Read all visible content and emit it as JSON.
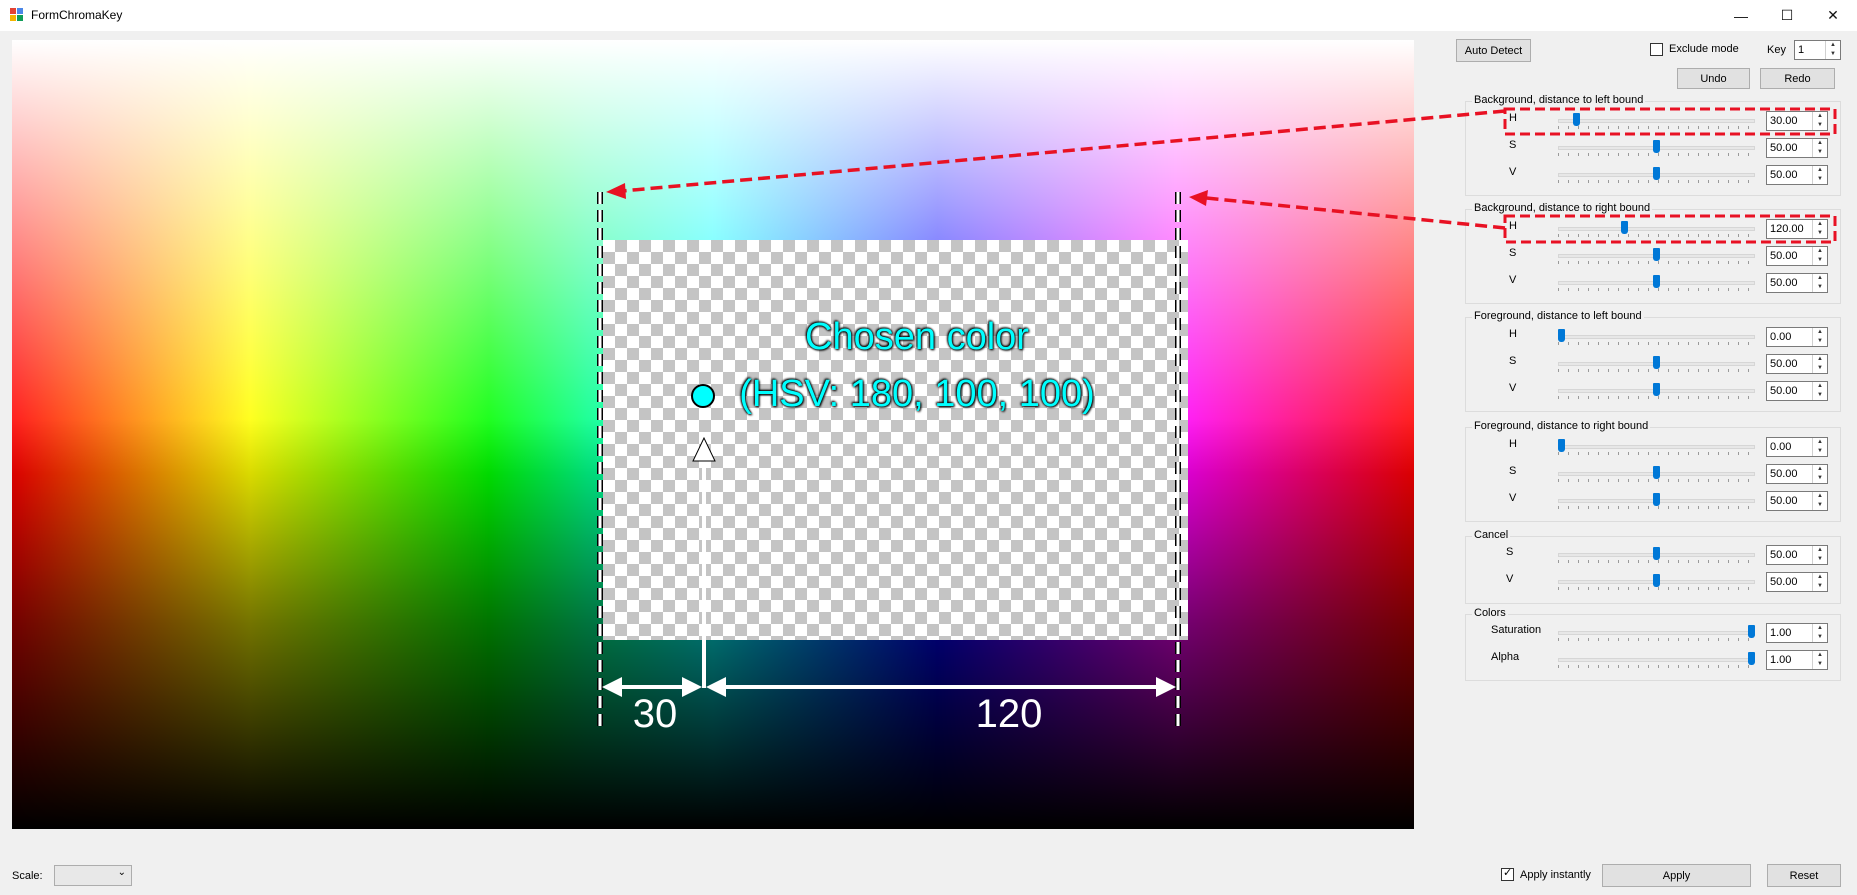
{
  "window": {
    "title": "FormChromaKey",
    "minimize_icon": "—",
    "maximize_icon": "☐",
    "close_icon": "✕"
  },
  "canvas": {
    "chosen_color_line1": "Chosen color",
    "chosen_color_line2": "(HSV: 180, 100, 100)",
    "left_distance": "30",
    "right_distance": "120"
  },
  "toolbar": {
    "auto_detect": "Auto Detect",
    "exclude_mode": "Exclude mode",
    "exclude_checked": false,
    "key_label": "Key",
    "key_value": "1",
    "undo": "Undo",
    "redo": "Redo"
  },
  "groups": {
    "bg_left": {
      "title": "Background, distance to left bound",
      "rows": [
        {
          "label": "H",
          "value": "30.00",
          "fraction": 0.08
        },
        {
          "label": "S",
          "value": "50.00",
          "fraction": 0.5
        },
        {
          "label": "V",
          "value": "50.00",
          "fraction": 0.5
        }
      ]
    },
    "bg_right": {
      "title": "Background, distance to right bound",
      "rows": [
        {
          "label": "H",
          "value": "120.00",
          "fraction": 0.33
        },
        {
          "label": "S",
          "value": "50.00",
          "fraction": 0.5
        },
        {
          "label": "V",
          "value": "50.00",
          "fraction": 0.5
        }
      ]
    },
    "fg_left": {
      "title": "Foreground, distance to left bound",
      "rows": [
        {
          "label": "H",
          "value": "0.00",
          "fraction": 0.0
        },
        {
          "label": "S",
          "value": "50.00",
          "fraction": 0.5
        },
        {
          "label": "V",
          "value": "50.00",
          "fraction": 0.5
        }
      ]
    },
    "fg_right": {
      "title": "Foreground, distance to right bound",
      "rows": [
        {
          "label": "H",
          "value": "0.00",
          "fraction": 0.0
        },
        {
          "label": "S",
          "value": "50.00",
          "fraction": 0.5
        },
        {
          "label": "V",
          "value": "50.00",
          "fraction": 0.5
        }
      ]
    },
    "cancel": {
      "title": "Cancel",
      "rows": [
        {
          "label": "S",
          "value": "50.00",
          "fraction": 0.5
        },
        {
          "label": "V",
          "value": "50.00",
          "fraction": 0.5
        }
      ]
    },
    "colors": {
      "title": "Colors",
      "rows": [
        {
          "label": "Saturation",
          "value": "1.00",
          "fraction": 1.0
        },
        {
          "label": "Alpha",
          "value": "1.00",
          "fraction": 1.0
        }
      ]
    }
  },
  "footer": {
    "scale_label": "Scale:",
    "scale_value": "",
    "apply_instantly": "Apply instantly",
    "apply_instantly_checked": true,
    "apply": "Apply",
    "reset": "Reset"
  },
  "colors": {
    "annotation_red": "#e81123",
    "chosen_color": "#00ffff",
    "slider_thumb": "#0078d7"
  }
}
